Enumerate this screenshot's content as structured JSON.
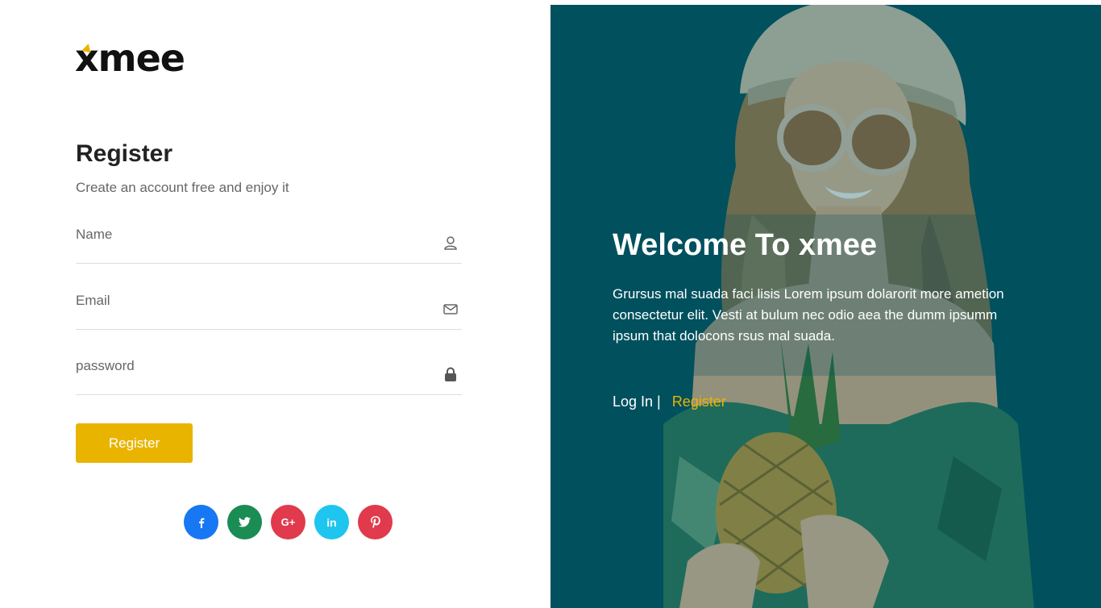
{
  "brand": {
    "logo": "xmee",
    "accent": "#e9b400"
  },
  "form": {
    "title": "Register",
    "subtitle": "Create an account free and enjoy it",
    "fields": [
      {
        "label": "Name",
        "icon": "user-icon"
      },
      {
        "label": "Email",
        "icon": "envelope-icon"
      },
      {
        "label": "password",
        "icon": "lock-icon"
      }
    ],
    "submit_label": "Register"
  },
  "socials": [
    {
      "name": "facebook",
      "glyph": "f",
      "color": "#1877f2"
    },
    {
      "name": "twitter",
      "glyph": "t",
      "color": "#1a8c54"
    },
    {
      "name": "google-plus",
      "glyph": "G+",
      "color": "#e03a4c"
    },
    {
      "name": "linkedin",
      "glyph": "in",
      "color": "#1ec5ee"
    },
    {
      "name": "pinterest",
      "glyph": "p",
      "color": "#e03a4c"
    }
  ],
  "hero": {
    "title": "Welcome To xmee",
    "description": "Grursus mal suada faci lisis Lorem ipsum dolarorit more ametion consectetur elit. Vesti at bulum nec odio aea the dumm ipsumm ipsum that dolocons rsus mal suada.",
    "login_label": "Log In",
    "separator": "|",
    "register_label": "Register",
    "background": "#00505e"
  }
}
